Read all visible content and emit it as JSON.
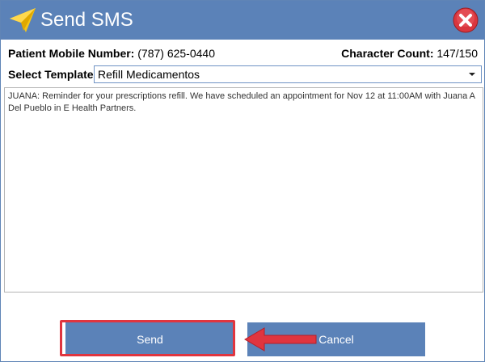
{
  "window": {
    "title": "Send SMS",
    "icon": "paper-plane-icon",
    "close_icon": "close-icon",
    "accent_color": "#5b82b8",
    "close_color": "#d9363e"
  },
  "info": {
    "mobile_label": "Patient Mobile Number:",
    "mobile_value": "(787) 625-0440",
    "count_label": "Character Count:",
    "count_value": "147/150"
  },
  "template": {
    "label": "Select Template:",
    "selected": "Refill Medicamentos"
  },
  "message": {
    "text": "JUANA: Reminder for your prescriptions refill. We have scheduled an appointment for Nov 12 at 11:00AM with Juana A Del Pueblo in E Health Partners."
  },
  "buttons": {
    "send": "Send",
    "cancel": "Cancel"
  },
  "annotation": {
    "highlight_color": "#e0353f",
    "arrow_icon": "left-arrow-icon"
  }
}
